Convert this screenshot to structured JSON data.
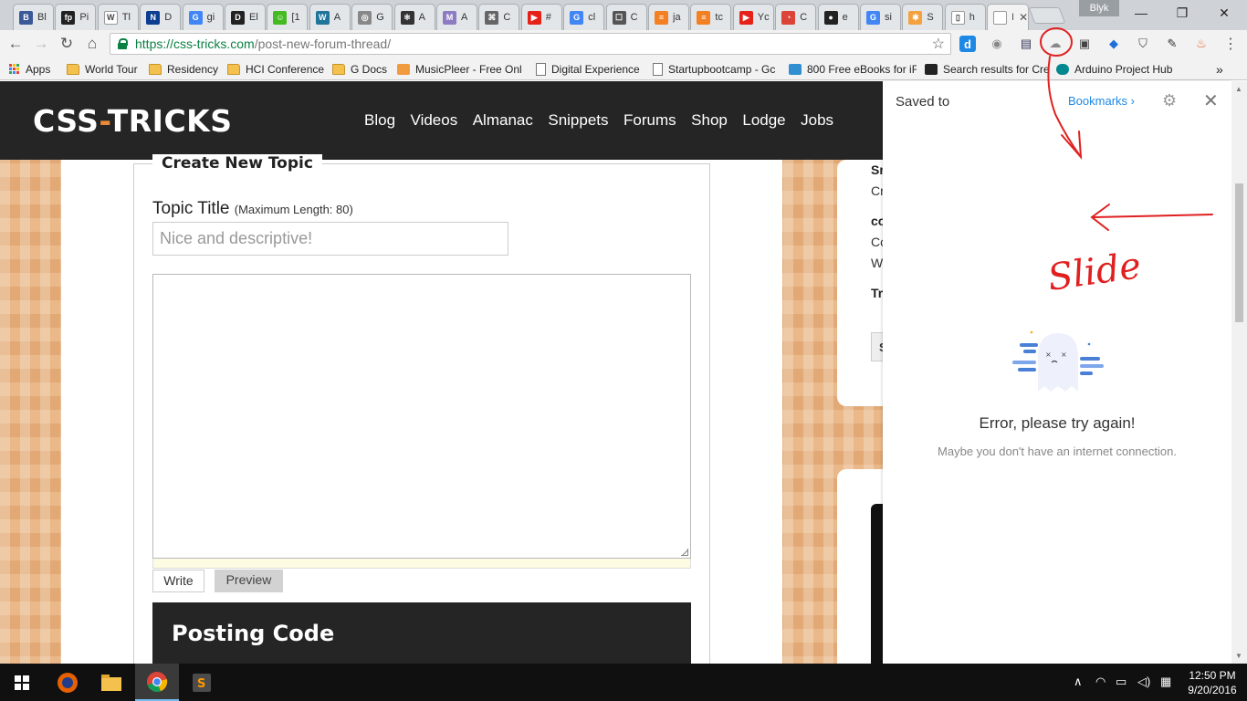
{
  "browser": {
    "tabs": [
      {
        "short": "Bl",
        "icon_color": "#3b5998",
        "icon_char": "B"
      },
      {
        "short": "Pi",
        "icon_color": "#222222",
        "icon_char": "fp"
      },
      {
        "short": "Tl",
        "icon_color": "#ffffff",
        "icon_char": "W"
      },
      {
        "short": "D",
        "icon_color": "#0b3d91",
        "icon_char": "N"
      },
      {
        "short": "gi",
        "icon_color": "#4285f4",
        "icon_char": "G"
      },
      {
        "short": "El",
        "icon_color": "#222222",
        "icon_char": "D"
      },
      {
        "short": "[1",
        "icon_color": "#44bb22",
        "icon_char": "☺"
      },
      {
        "short": "A",
        "icon_color": "#21759b",
        "icon_char": "W"
      },
      {
        "short": "G",
        "icon_color": "#888888",
        "icon_char": "◎"
      },
      {
        "short": "A",
        "icon_color": "#333333",
        "icon_char": "⚛"
      },
      {
        "short": "A",
        "icon_color": "#8e7cc3",
        "icon_char": "M"
      },
      {
        "short": "C",
        "icon_color": "#666666",
        "icon_char": "⌘"
      },
      {
        "short": "#",
        "icon_color": "#e62117",
        "icon_char": "▶"
      },
      {
        "short": "cl",
        "icon_color": "#4285f4",
        "icon_char": "G"
      },
      {
        "short": "C",
        "icon_color": "#555555",
        "icon_char": "☐"
      },
      {
        "short": "ja",
        "icon_color": "#f48024",
        "icon_char": "≡"
      },
      {
        "short": "tc",
        "icon_color": "#f48024",
        "icon_char": "≡"
      },
      {
        "short": "Yc",
        "icon_color": "#e62117",
        "icon_char": "▶"
      },
      {
        "short": "C",
        "icon_color": "#db4437",
        "icon_char": "◔"
      },
      {
        "short": "e",
        "icon_color": "#222222",
        "icon_char": "●"
      },
      {
        "short": "si",
        "icon_color": "#4285f4",
        "icon_char": "G"
      },
      {
        "short": "S",
        "icon_color": "#f4a13f",
        "icon_char": "✱"
      },
      {
        "short": "h",
        "icon_color": "#ffffff",
        "icon_char": "▯"
      },
      {
        "short": "Pc",
        "icon_color": "#ffffff",
        "icon_char": ""
      }
    ],
    "profile_name": "Blyk",
    "url_host": "https://css-tricks.com",
    "url_path": "/post-new-forum-thread/",
    "bookmarks": [
      {
        "label": "Apps",
        "icon": "apps-icon"
      },
      {
        "label": "World Tour",
        "icon": "folder-icon"
      },
      {
        "label": "Residency",
        "icon": "folder-icon"
      },
      {
        "label": "HCI Conference",
        "icon": "folder-icon"
      },
      {
        "label": "G Docs",
        "icon": "folder-icon"
      },
      {
        "label": "MusicPleer - Free Onl",
        "icon": "music-icon"
      },
      {
        "label": "Digital Experience",
        "icon": "page-icon"
      },
      {
        "label": "Startupbootcamp - Gc",
        "icon": "page-icon"
      },
      {
        "label": "800 Free eBooks for iF",
        "icon": "book-icon"
      },
      {
        "label": "Search results for Cre",
        "icon": "search-icon"
      },
      {
        "label": "Arduino Project Hub",
        "icon": "arduino-icon"
      }
    ]
  },
  "site": {
    "logo_left": "CSS",
    "logo_dash": "-",
    "logo_right": "TRICKS",
    "nav": [
      "Blog",
      "Videos",
      "Almanac",
      "Snippets",
      "Forums",
      "Shop",
      "Lodge",
      "Jobs"
    ],
    "form": {
      "legend": "Create New Topic",
      "title_label": "Topic Title",
      "title_hint": "(Maximum Length: 80)",
      "title_placeholder": "Nice and descriptive!",
      "tab_write": "Write",
      "tab_preview": "Preview",
      "posting_code_heading": "Posting Code"
    },
    "sidebar": {
      "line1": "Sr",
      "line2": "Cr",
      "line3": "co",
      "line4": "Co",
      "line5": "W",
      "line6": "Tr",
      "button": "S"
    }
  },
  "panel": {
    "title": "Saved to",
    "link": "Bookmarks",
    "error_title": "Error, please try again!",
    "error_subtitle": "Maybe you don't have an internet connection."
  },
  "annotation": {
    "text": "Slide",
    "color": "#e02020"
  },
  "taskbar": {
    "time": "12:50 PM",
    "date": "9/20/2016"
  }
}
